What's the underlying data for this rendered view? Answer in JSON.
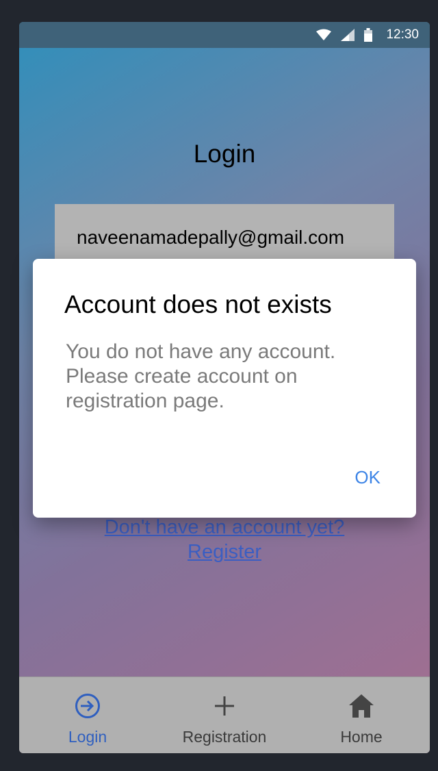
{
  "status_bar": {
    "time": "12:30",
    "icons": [
      "wifi-icon",
      "signal-icon",
      "battery-icon"
    ]
  },
  "login": {
    "title": "Login",
    "email_value": "naveenamadepally@gmail.com",
    "register_link_line1": "Don't have an account yet?",
    "register_link_line2": "Register"
  },
  "dialog": {
    "title": "Account does not exists",
    "message": "You do not have any account. Please create account on registration page.",
    "ok_label": "OK"
  },
  "bottom_nav": {
    "items": [
      {
        "label": "Login",
        "icon": "login-icon",
        "active": true
      },
      {
        "label": "Registration",
        "icon": "plus-icon",
        "active": false
      },
      {
        "label": "Home",
        "icon": "home-icon",
        "active": false
      }
    ]
  },
  "colors": {
    "status_bar": "#3f6279",
    "active_nav": "#2f5fbf",
    "dialog_button": "#3d84e6",
    "link": "#3a5ec2"
  }
}
